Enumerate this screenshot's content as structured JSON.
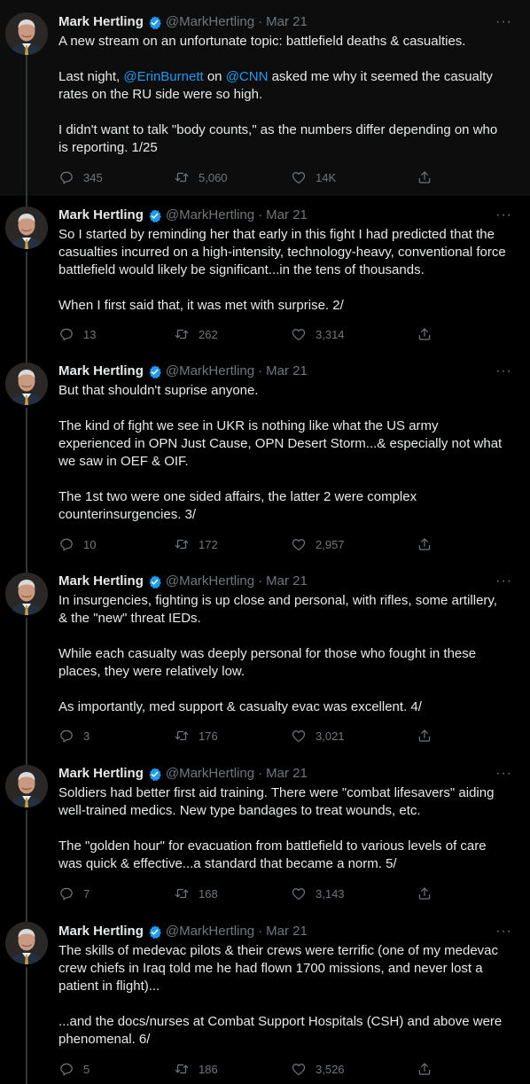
{
  "tweets": [
    {
      "name": "Mark Hertling",
      "handle": "@MarkHertling",
      "date": "Mar 21",
      "paragraphs": [
        [
          {
            "t": "A new stream on an unfortunate topic: battlefield deaths & casualties."
          }
        ],
        [
          {
            "t": "Last night, "
          },
          {
            "t": "@ErinBurnett",
            "m": true
          },
          {
            "t": " on "
          },
          {
            "t": "@CNN",
            "m": true
          },
          {
            "t": " asked me why it seemed the casualty rates on the RU side were so high."
          }
        ],
        [
          {
            "t": "I didn't want to talk \"body counts,\" as the numbers differ depending on who is reporting. 1/25"
          }
        ]
      ],
      "replies": "345",
      "retweets": "5,060",
      "likes": "14K"
    },
    {
      "name": "Mark Hertling",
      "handle": "@MarkHertling",
      "date": "Mar 21",
      "paragraphs": [
        [
          {
            "t": "So I started by reminding her that early in this fight I had predicted that the casualties incurred on a high-intensity, technology-heavy, conventional force battlefield would likely be significant...in the tens of thousands."
          }
        ],
        [
          {
            "t": "When I first said that, it was met with surprise.  2/"
          }
        ]
      ],
      "replies": "13",
      "retweets": "262",
      "likes": "3,314"
    },
    {
      "name": "Mark Hertling",
      "handle": "@MarkHertling",
      "date": "Mar 21",
      "paragraphs": [
        [
          {
            "t": "But that shouldn't suprise anyone."
          }
        ],
        [
          {
            "t": "The kind of fight we see in UKR is nothing like what the US army experienced in OPN Just Cause, OPN Desert Storm...& especially not what we saw in OEF & OIF."
          }
        ],
        [
          {
            "t": "The 1st two were one sided affairs, the latter 2 were complex counterinsurgencies. 3/"
          }
        ]
      ],
      "replies": "10",
      "retweets": "172",
      "likes": "2,957"
    },
    {
      "name": "Mark Hertling",
      "handle": "@MarkHertling",
      "date": "Mar 21",
      "paragraphs": [
        [
          {
            "t": "In insurgencies, fighting is up close and personal, with rifles, some artillery, & the \"new\" threat IEDs."
          }
        ],
        [
          {
            "t": "While each casualty was deeply personal for those who fought in these places, they were relatively low."
          }
        ],
        [
          {
            "t": "As importantly, med support & casualty evac was excellent. 4/"
          }
        ]
      ],
      "replies": "3",
      "retweets": "176",
      "likes": "3,021"
    },
    {
      "name": "Mark Hertling",
      "handle": "@MarkHertling",
      "date": "Mar 21",
      "paragraphs": [
        [
          {
            "t": "Soldiers had better first aid training.  There were \"combat lifesavers\" aiding well-trained medics.  New type bandages to treat wounds, etc."
          }
        ],
        [
          {
            "t": "The \"golden hour\" for evacuation from battlefield to various levels of care was quick & effective...a standard that became a norm.   5/"
          }
        ]
      ],
      "replies": "7",
      "retweets": "168",
      "likes": "3,143"
    },
    {
      "name": "Mark Hertling",
      "handle": "@MarkHertling",
      "date": "Mar 21",
      "paragraphs": [
        [
          {
            "t": "The skills of medevac pilots & their crews were terrific (one of my medevac crew chiefs in Iraq told me he had flown 1700 missions, and never lost a patient in flight)..."
          }
        ],
        [
          {
            "t": "...and the docs/nurses at Combat Support Hospitals (CSH) and above were phenomenal.  6/"
          }
        ]
      ],
      "replies": "5",
      "retweets": "186",
      "likes": "3,526"
    }
  ],
  "icons": {
    "verified": "verified-badge-icon",
    "more": "more-icon",
    "reply": "reply-icon",
    "retweet": "retweet-icon",
    "like": "like-icon",
    "share": "share-icon"
  },
  "colors": {
    "background": "#000000",
    "text": "#e7e9ea",
    "muted": "#71767b",
    "link": "#1d9bf0",
    "verified": "#1d9bf0"
  },
  "ui": {
    "separator": "·",
    "more_glyph": "···"
  }
}
